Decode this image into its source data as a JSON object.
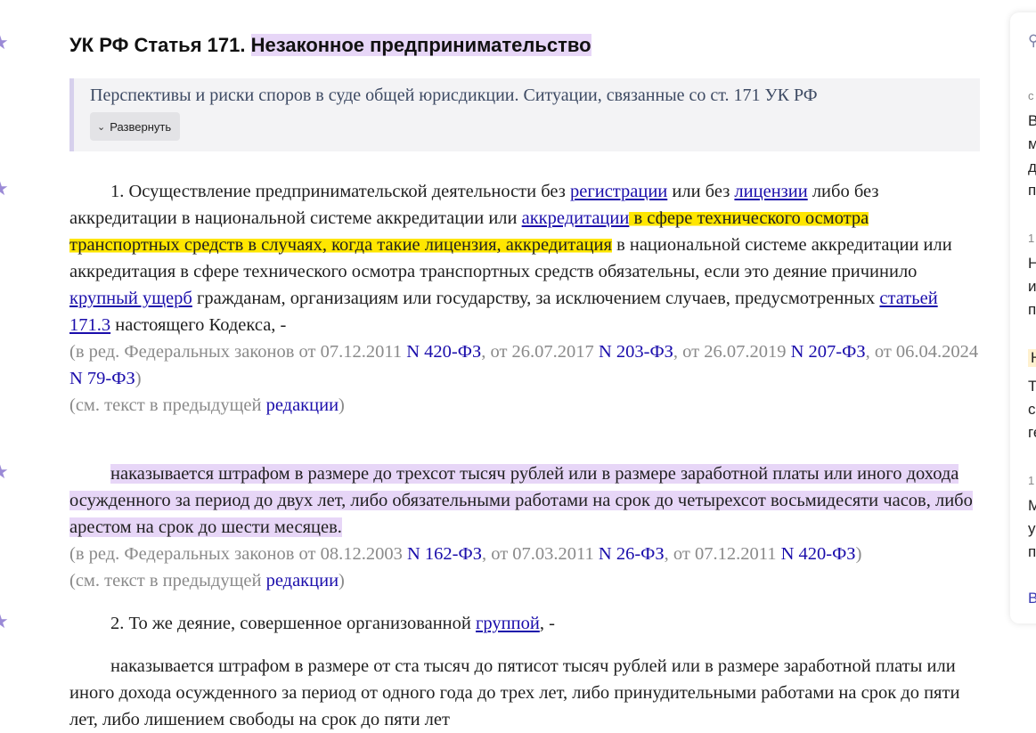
{
  "title": {
    "prefix": "УК РФ Статья 171.",
    "highlighted": "Незаконное предпринимательство"
  },
  "summary": {
    "text": "Перспективы и риски споров в суде общей юрисдикции. Ситуации, связанные со ст. 171 УК РФ",
    "expand_label": "Развернуть"
  },
  "part1": {
    "t1": "1. Осуществление предпринимательской деятельности без ",
    "link_registration": "регистрации",
    "t2": " или без ",
    "link_license": "лицензии",
    "t3": " либо без аккредитации в национальной системе аккредитации или ",
    "link_accreditation": "аккредитации",
    "hl_yellow": " в сфере технического осмотра транспортных средств в случаях, когда такие лицензия, аккредитация",
    "t4": " в национальной системе аккредитации или аккредитация в сфере технического осмотра транспортных средств обязательны, если это деяние причинило ",
    "link_damage": "крупный ущерб",
    "t5": " гражданам, организациям или государству, за исключением случаев, предусмотренных ",
    "link_article": "статьей 171.3",
    "t6": " настоящего Кодекса, -"
  },
  "note1": {
    "t1": "(в ред. Федеральных законов от 07.12.2011 ",
    "ref1": "N 420-ФЗ",
    "t2": ", от 26.07.2017 ",
    "ref2": "N 203-ФЗ",
    "t3": ", от 26.07.2019 ",
    "ref3": "N 207-ФЗ",
    "t4": ", от 06.04.2024 ",
    "ref4": "N 79-ФЗ",
    "t5": ")"
  },
  "see1": {
    "t1": "(см. текст в предыдущей ",
    "link": "редакции",
    "t2": ")"
  },
  "penalty1": "наказывается штрафом в размере до трехсот тысяч рублей или в размере заработной платы или иного дохода осужденного за период до двух лет, либо обязательными работами на срок до четырехсот восьмидесяти часов, либо арестом на срок до шести месяцев.",
  "note2": {
    "t1": "(в ред. Федеральных законов от 08.12.2003 ",
    "ref1": "N 162-ФЗ",
    "t2": ", от 07.03.2011 ",
    "ref2": "N 26-ФЗ",
    "t3": ", от 07.12.2011 ",
    "ref3": "N 420-ФЗ",
    "t4": ")"
  },
  "see2": {
    "t1": "(см. текст в предыдущей ",
    "link": "редакции",
    "t2": ")"
  },
  "part2": {
    "t1": "2. То же деяние, совершенное организованной ",
    "link": "группой",
    "t2": ", -"
  },
  "penalty2": "наказывается штрафом в размере от ста тысяч до пятисот тысяч рублей или в размере заработной платы или иного дохода осужденного за период от одного года до трех лет, либо принудительными работами на срок до пяти лет, либо лишением свободы на срок до пяти лет",
  "right_panel": {
    "letters": [
      "с",
      "В",
      "м",
      "д",
      "п",
      "1",
      "Н",
      "и",
      "п",
      "Н",
      "Т",
      "с",
      "ге",
      "1",
      "М",
      "у",
      "п",
      "В"
    ]
  },
  "colors": {
    "highlight_purple": "#e7d6f7",
    "highlight_yellow": "#ffe600",
    "link": "#1a0dab",
    "note": "#8a8a8a",
    "star": "#9b8ad6"
  },
  "icons": [
    "star-icon",
    "chevron-down-icon",
    "pin-icon"
  ]
}
